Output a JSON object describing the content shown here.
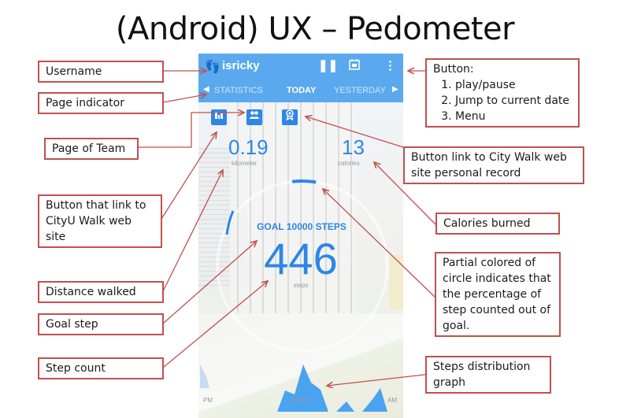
{
  "slide_title": "(Android) UX – Pedometer",
  "app": {
    "username": "isricky",
    "icons": {
      "logo": "footprints-icon",
      "pause": "pause-icon",
      "calendar": "calendar-icon",
      "menu": "more-vert-icon"
    },
    "tabs": [
      {
        "label": "STATISTICS",
        "active": false
      },
      {
        "label": "TODAY",
        "active": true
      },
      {
        "label": "YESTERDAY",
        "active": false
      }
    ],
    "tab_prev_arrow": "◀",
    "tab_next_arrow": "▶",
    "quick_buttons": [
      {
        "name": "statistics-link-button",
        "glyph": "▐▌"
      },
      {
        "name": "team-button",
        "glyph": "👥"
      },
      {
        "name": "personal-record-button",
        "glyph": "🏅"
      }
    ],
    "distance": {
      "value": "0.19",
      "label": "kilometer"
    },
    "calories": {
      "value": "13",
      "label": "calories"
    },
    "goal_text": "GOAL 10000 STEPS",
    "step_count": "446",
    "step_label": "steps",
    "goal_progress_fraction": 0.0446,
    "graph_axis": {
      "left": "PM",
      "center": "NOON",
      "right": "AM"
    },
    "accent_color": "#2e86e5",
    "appbar_color": "#5aa9ee"
  },
  "callouts": {
    "username": "Username",
    "page_indicator": "Page indicator",
    "page_of_team": "Page of Team",
    "citywalk_button": "Button that link to CityU Walk web site",
    "distance": "Distance walked",
    "goal": "Goal step",
    "step_count": "Step count",
    "buttons_title": "Button:",
    "buttons_list": [
      "play/pause",
      "Jump to current date",
      "Menu"
    ],
    "record_button": "Button link to City Walk web site personal record",
    "calories": "Calories burned",
    "partial_circle": "Partial colored of circle indicates that the percentage of step counted out of goal.",
    "distribution": "Steps distribution graph"
  },
  "callout_border_color": "#c0504d"
}
